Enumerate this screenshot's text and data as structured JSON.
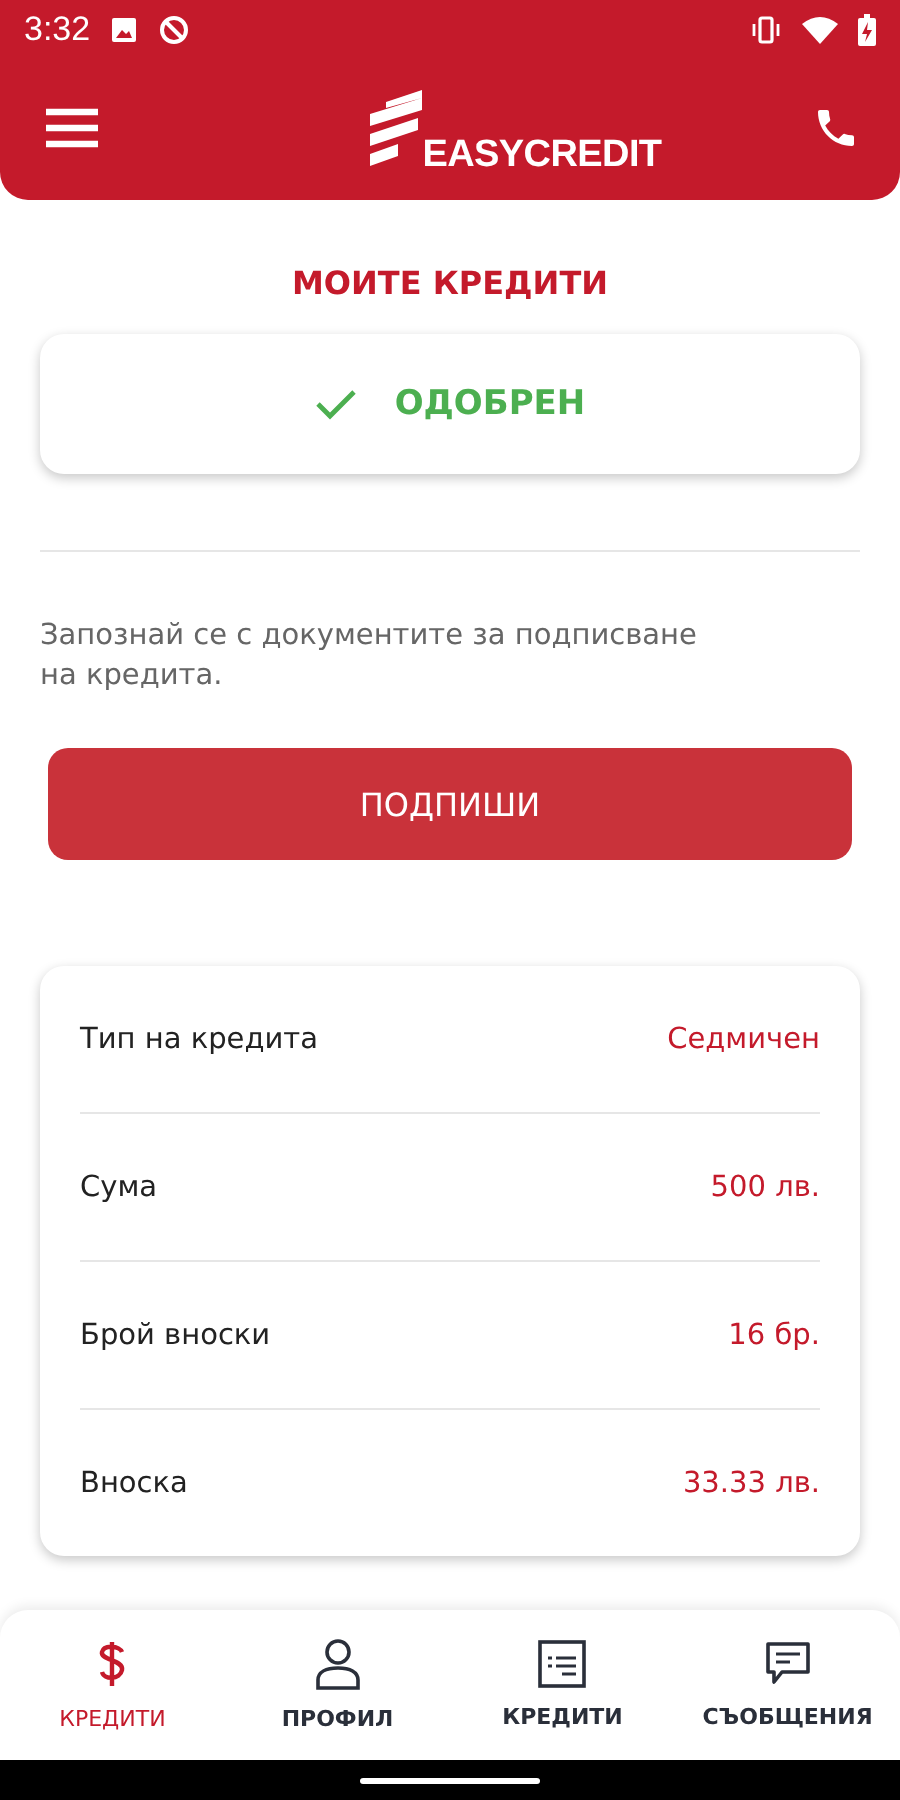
{
  "status_bar": {
    "time": "3:32"
  },
  "header": {
    "logo": "EASYCREDIT"
  },
  "page_title": "МОИТЕ КРЕДИТИ",
  "status_card": {
    "label": "ОДОБРЕН",
    "approved": true
  },
  "instruction": "Запознай се с документите за подписване на кредита.",
  "sign_button": "ПОДПИШИ",
  "details": [
    {
      "label": "Тип на кредита",
      "value": "Седмичен"
    },
    {
      "label": "Сума",
      "value": "500 лв."
    },
    {
      "label": "Брой вноски",
      "value": "16 бр."
    },
    {
      "label": "Вноска",
      "value": "33.33 лв."
    }
  ],
  "bottom_nav": [
    {
      "label": "КРЕДИТИ",
      "selected": true
    },
    {
      "label": "ПРОФИЛ",
      "selected": false
    },
    {
      "label": "КРЕДИТИ",
      "selected": false
    },
    {
      "label": "СЪОБЩЕНИЯ",
      "selected": false
    }
  ]
}
